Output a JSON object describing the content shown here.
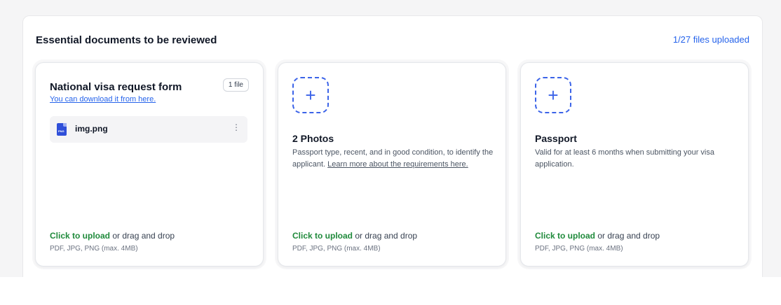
{
  "section": {
    "title": "Essential documents to be reviewed",
    "upload_count": "1/27 files uploaded"
  },
  "cards": [
    {
      "title": "National visa request form",
      "badge": "1 file",
      "download_link": "You can download it from here.",
      "file": {
        "icon_label": "PNG",
        "name": "img.png",
        "menu": "⋮"
      },
      "upload_link": "Click to upload",
      "upload_rest": " or drag and drop",
      "upload_hint": "PDF, JPG, PNG (max. 4MB)"
    },
    {
      "add_icon": "+",
      "title": "2 Photos",
      "description": "Passport type, recent, and in good condition, to identify the applicant. ",
      "learn_link": "Learn more about the requirements here.",
      "upload_link": "Click to upload",
      "upload_rest": " or drag and drop",
      "upload_hint": "PDF, JPG, PNG (max. 4MB)"
    },
    {
      "add_icon": "+",
      "title": "Passport",
      "description": "Valid for at least 6 months when submitting your visa application.",
      "upload_link": "Click to upload",
      "upload_rest": " or drag and drop",
      "upload_hint": "PDF, JPG, PNG (max. 4MB)"
    }
  ],
  "colors": {
    "accent_blue": "#2563eb",
    "upload_green": "#1f8a3b",
    "file_icon_blue": "#2f4fd9"
  },
  "icons": {
    "file": "png-file-icon",
    "menu": "kebab-menu-icon",
    "add": "plus-icon"
  }
}
